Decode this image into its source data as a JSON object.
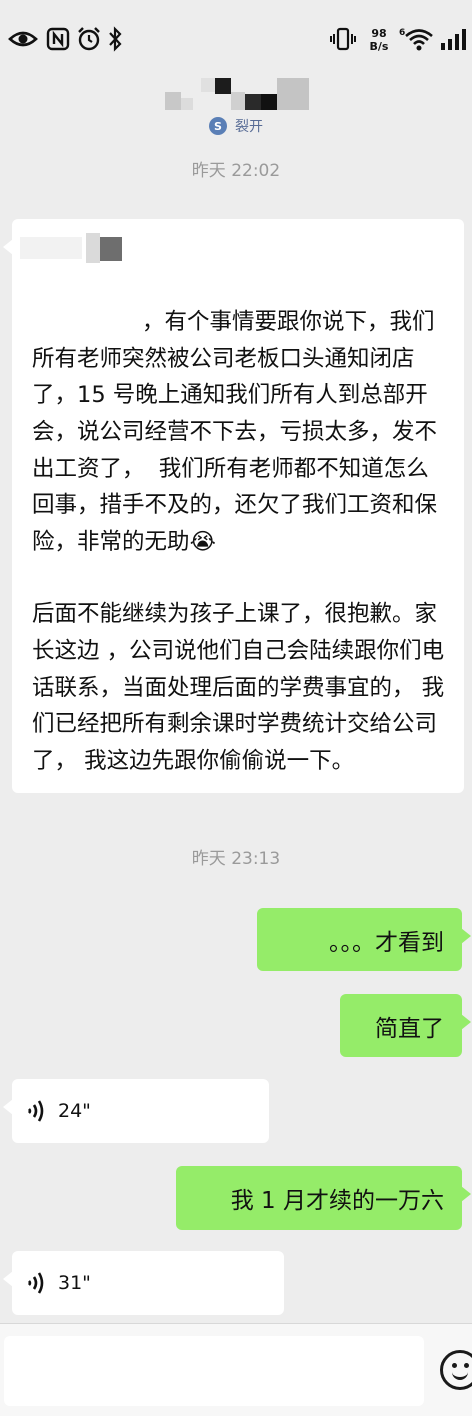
{
  "status_bar": {
    "net_speed_value": "98",
    "net_speed_unit": "B/s",
    "wifi_label": "6",
    "icons": [
      "eye-comfort-icon",
      "nfc-icon",
      "alarm-icon",
      "bluetooth-icon",
      "vibrate-icon",
      "wifi-icon",
      "signal-icon"
    ]
  },
  "header": {
    "split_label": "裂开",
    "split_badge": "S"
  },
  "messages": {
    "time_1": "昨天 22:02",
    "long_msg_p1": "，有个事情要跟你说下，我们所有老师突然被公司老板口头通知闭店了，15 号晚上通知我们所有人到总部开会，说公司经营不下去，亏损太多，发不出工资了，  我们所有老师都不知道怎么回事，措手不及的，还欠了我们工资和保险，非常的无助",
    "long_msg_emoji": "😭",
    "long_msg_p2": "后面不能继续为孩子上课了，很抱歉。家长这边 ，公司说他们自己会陆续跟你们电话联系，当面处理后面的学费事宜的， 我们已经把所有剩余课时学费统计交给公司了， 我这边先跟你偷偷说一下。",
    "time_2": "昨天 23:13",
    "out_1": "。。。才看到",
    "out_2": "简直了",
    "voice_1": "24\"",
    "out_3": "我 1 月才续的一万六",
    "voice_2": "31\""
  }
}
